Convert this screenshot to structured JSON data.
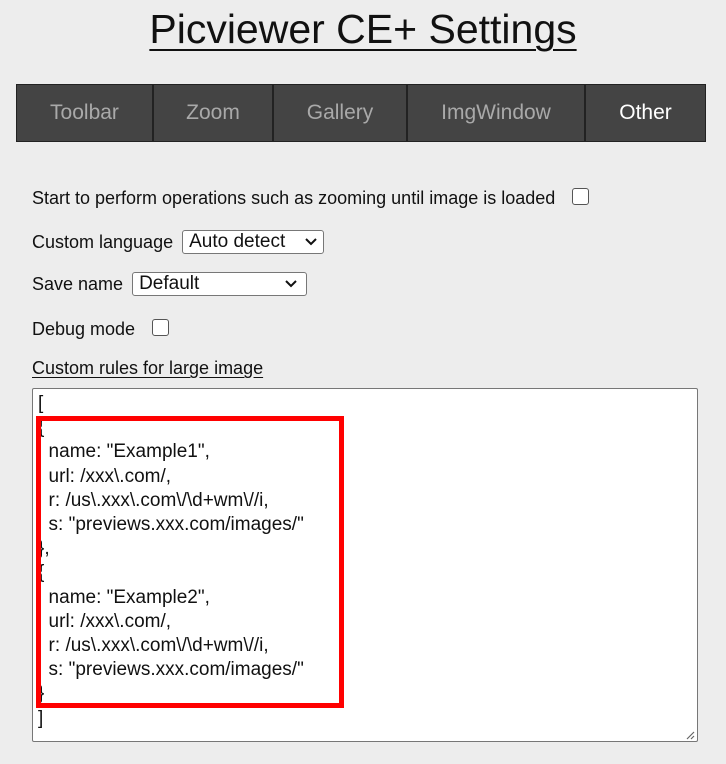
{
  "page": {
    "title": "Picviewer CE+ Settings"
  },
  "tabs": [
    {
      "label": "Toolbar",
      "active": false
    },
    {
      "label": "Zoom",
      "active": false
    },
    {
      "label": "Gallery",
      "active": false
    },
    {
      "label": "ImgWindow",
      "active": false
    },
    {
      "label": "Other",
      "active": true
    }
  ],
  "settings": {
    "wait_loaded": {
      "label": "Start to perform operations such as zooming until image is loaded",
      "checked": false
    },
    "custom_language": {
      "label": "Custom language",
      "value": "Auto detect"
    },
    "save_name": {
      "label": "Save name",
      "value": "Default"
    },
    "debug_mode": {
      "label": "Debug mode",
      "checked": false
    },
    "custom_rules": {
      "label": "Custom rules for large image",
      "value": "[\n{\n  name: \"Example1\",\n  url: /xxx\\.com/,\n  r: /us\\.xxx\\.com\\/\\d+wm\\//i,\n  s: \"previews.xxx.com/images/\"\n},\n{\n  name: \"Example2\",\n  url: /xxx\\.com/,\n  r: /us\\.xxx\\.com\\/\\d+wm\\//i,\n  s: \"previews.xxx.com/images/\"\n}\n]"
    }
  },
  "colors": {
    "highlight": "#ff0000",
    "tabbar": "#444444",
    "active_tab_text": "#ffffff",
    "inactive_tab_text": "#a9a9a9"
  }
}
